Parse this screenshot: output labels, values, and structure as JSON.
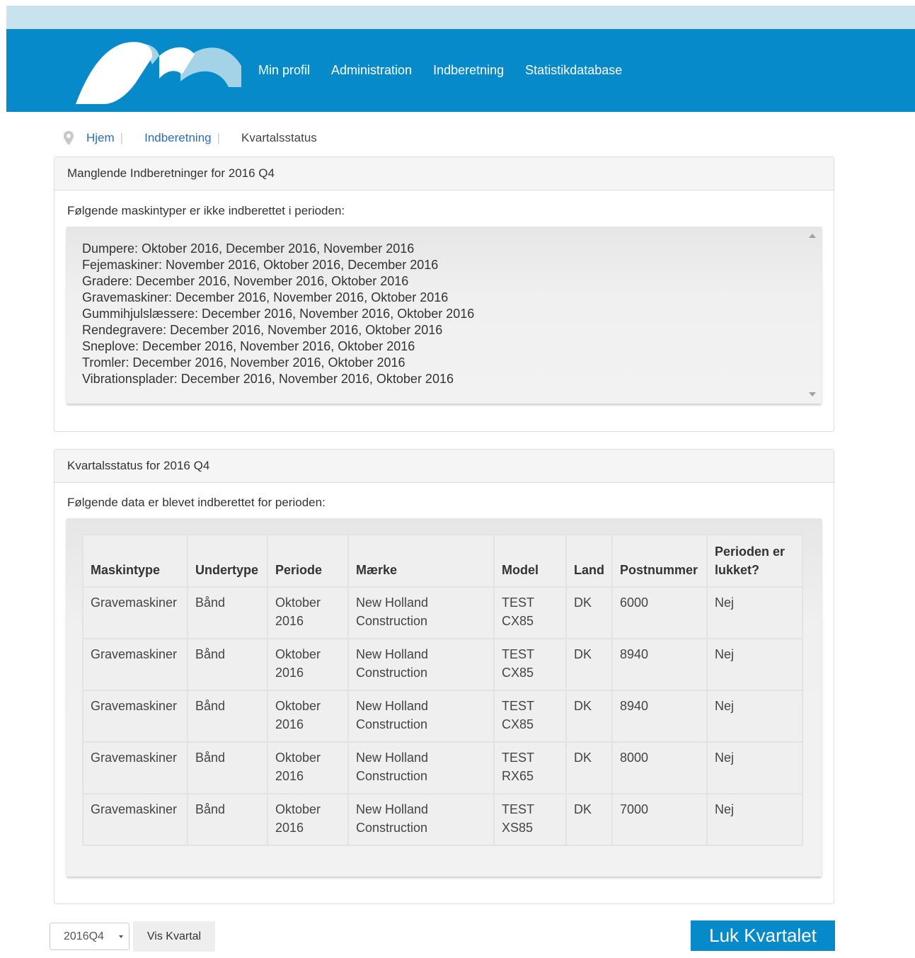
{
  "brand": {
    "primary": "#078ac9",
    "topbar": "#c8e3ee",
    "link": "#2a6ebb"
  },
  "nav": {
    "items": [
      "Min profil",
      "Administration",
      "Indberetning",
      "Statistikdatabase"
    ]
  },
  "breadcrumb": {
    "icon": "map-pin-icon",
    "home": "Hjem",
    "section": "Indberetning",
    "current": "Kvartalsstatus"
  },
  "missing_panel": {
    "title": "Manglende Indberetninger for 2016 Q4",
    "intro": "Følgende maskintyper er ikke indberettet i perioden:",
    "items": [
      "Dumpere: Oktober 2016, December 2016, November 2016",
      "Fejemaskiner: November 2016, Oktober 2016, December 2016",
      "Gradere: December 2016, November 2016, Oktober 2016",
      "Gravemaskiner: December 2016, November 2016, Oktober 2016",
      "Gummihjulslæssere: December 2016, November 2016, Oktober 2016",
      "Rendegravere: December 2016, November 2016, Oktober 2016",
      "Sneplove: December 2016, November 2016, Oktober 2016",
      "Tromler: December 2016, November 2016, Oktober 2016",
      "Vibrationsplader: December 2016, November 2016, Oktober 2016"
    ]
  },
  "status_panel": {
    "title": "Kvartalsstatus for 2016 Q4",
    "intro": "Følgende data er blevet indberettet for perioden:",
    "headers": [
      "Maskintype",
      "Undertype",
      "Periode",
      "Mærke",
      "Model",
      "Land",
      "Postnummer",
      "Perioden er lukket?"
    ],
    "rows": [
      [
        "Gravemaskiner",
        "Bånd",
        "Oktober 2016",
        "New Holland Construction",
        "TEST CX85",
        "DK",
        "6000",
        "Nej"
      ],
      [
        "Gravemaskiner",
        "Bånd",
        "Oktober 2016",
        "New Holland Construction",
        "TEST CX85",
        "DK",
        "8940",
        "Nej"
      ],
      [
        "Gravemaskiner",
        "Bånd",
        "Oktober 2016",
        "New Holland Construction",
        "TEST CX85",
        "DK",
        "8940",
        "Nej"
      ],
      [
        "Gravemaskiner",
        "Bånd",
        "Oktober 2016",
        "New Holland Construction",
        "TEST RX65",
        "DK",
        "8000",
        "Nej"
      ],
      [
        "Gravemaskiner",
        "Bånd",
        "Oktober 2016",
        "New Holland Construction",
        "TEST XS85",
        "DK",
        "7000",
        "Nej"
      ]
    ]
  },
  "footer": {
    "quarter_select": "2016Q4",
    "show_button": "Vis Kvartal",
    "close_button": "Luk Kvartalet"
  }
}
